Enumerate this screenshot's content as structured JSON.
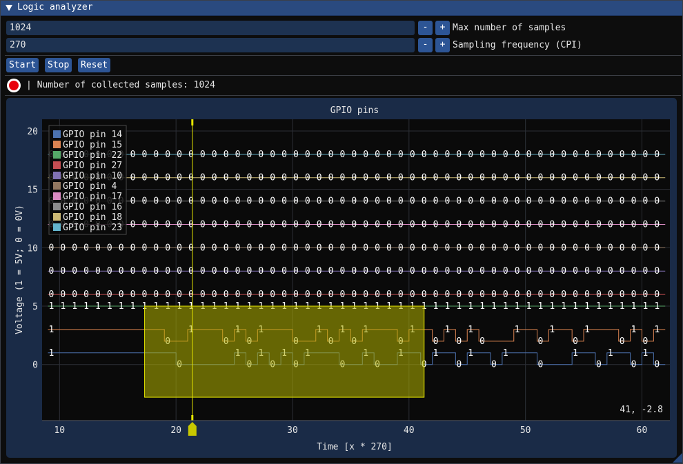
{
  "window": {
    "title": "Logic analyzer"
  },
  "controls": {
    "max_samples": {
      "value": "1024",
      "label": "Max number of samples"
    },
    "sampling_frequency": {
      "value": "270",
      "label": "Sampling frequency (CPI)"
    },
    "minus_label": "-",
    "plus_label": "+",
    "buttons": {
      "start": "Start",
      "stop": "Stop",
      "reset": "Reset"
    }
  },
  "status": {
    "text": "| Number of collected samples: 1024",
    "indicator_color": "#e8000b"
  },
  "plot": {
    "cursor_readout": "41, -2.8",
    "colors": {
      "background": "#0a0a0a",
      "panel": "#1a2b47",
      "grid": "#2c2f36",
      "selection": "#b3b300",
      "cursor": "#e6e600"
    }
  },
  "chart_data": {
    "type": "line",
    "title": "GPIO pins",
    "xlabel": "Time [x * 270]",
    "ylabel": "Voltage (1 = 5V; 0 = 0V)",
    "xlim": [
      8.5,
      62.4
    ],
    "ylim": [
      -4.8,
      21
    ],
    "x_ticks": [
      10,
      20,
      30,
      40,
      50,
      60
    ],
    "y_ticks": [
      0,
      5,
      10,
      15,
      20
    ],
    "grid": true,
    "legend_position": "top-left",
    "x_start": 9,
    "x_step": 1,
    "x_count": 53,
    "vertical_marker_x": 21.4,
    "selection_rect": {
      "x": [
        17.3,
        41.3
      ],
      "y": [
        -2.8,
        5.0
      ]
    },
    "series": [
      {
        "name": "GPIO pin 14",
        "color": "#4c72b0",
        "offset": 0,
        "values": "1111111111100000101010111001001101101101110001101101001001001101111111111101"
      },
      {
        "name": "GPIO pin 15",
        "color": "#dd8452",
        "offset": 2,
        "values": "11111111110011101011100101011101101010001101101110101011111111111111111111"
      },
      {
        "name": "GPIO pin 22",
        "color": "#55a868",
        "offset": 4,
        "values": "11111111111111111111111111111111111111111111111111111"
      },
      {
        "name": "GPIO pin 27",
        "color": "#c44e52",
        "offset": 6,
        "values": "00000000000000000000000000000000000000000000000000000"
      },
      {
        "name": "GPIO pin 10",
        "color": "#8172b3",
        "offset": 8,
        "values": "00000000000000000000000000000000000000000000000000000"
      },
      {
        "name": "GPIO pin 4",
        "color": "#937860",
        "offset": 10,
        "values": "00000000000000000000000000000000000000000000000000000"
      },
      {
        "name": "GPIO pin 17",
        "color": "#da8bc3",
        "offset": 12,
        "values": "00000000000000000000000000000000000000000000000000000"
      },
      {
        "name": "GPIO pin 16",
        "color": "#8c8c8c",
        "offset": 14,
        "values": "00000000000000000000000000000000000000000000000000000"
      },
      {
        "name": "GPIO pin 18",
        "color": "#ccb974",
        "offset": 16,
        "values": "00000000000000000000000000000000000000000000000000000"
      },
      {
        "name": "GPIO pin 23",
        "color": "#64b5cd",
        "offset": 18,
        "values": "00000000000000000000000000000000000000000000000000000"
      }
    ]
  }
}
